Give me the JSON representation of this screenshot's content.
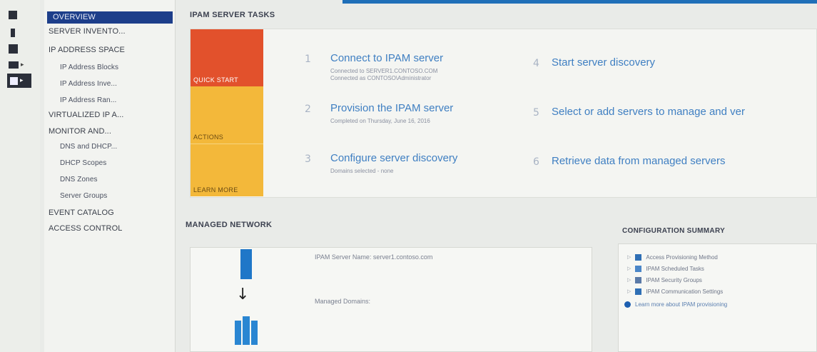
{
  "rail": {
    "icons": [
      "dashboard-icon",
      "server-icon",
      "servers-icon",
      "features-icon",
      "ipam-icon"
    ]
  },
  "nav": {
    "items": [
      {
        "label": "OVERVIEW",
        "level": 0,
        "selected": true
      },
      {
        "label": "SERVER INVENTO...",
        "level": 0
      },
      {
        "label": "IP ADDRESS SPACE",
        "level": 0
      },
      {
        "label": "IP Address Blocks",
        "level": 1
      },
      {
        "label": "IP Address Inve...",
        "level": 1
      },
      {
        "label": "IP Address Ran...",
        "level": 1
      },
      {
        "label": "VIRTUALIZED IP A...",
        "level": 0
      },
      {
        "label": "MONITOR AND...",
        "level": 0
      },
      {
        "label": "DNS and DHCP...",
        "level": 1
      },
      {
        "label": "DHCP Scopes",
        "level": 1
      },
      {
        "label": "DNS Zones",
        "level": 1
      },
      {
        "label": "Server Groups",
        "level": 1
      },
      {
        "label": "EVENT CATALOG",
        "level": 0
      },
      {
        "label": "ACCESS CONTROL",
        "level": 0
      }
    ]
  },
  "tasks": {
    "section_title": "IPAM SERVER TASKS",
    "tiles": [
      "QUICK START",
      "ACTIONS",
      "LEARN MORE"
    ],
    "items": [
      {
        "num": "1",
        "title": "Connect to IPAM server",
        "sub": [
          "Connected to SERVER1.CONTOSO.COM",
          "Connected as CONTOSO\\Administrator"
        ]
      },
      {
        "num": "2",
        "title": "Provision the IPAM server",
        "sub": [
          "Completed on Thursday, June 16, 2016"
        ]
      },
      {
        "num": "3",
        "title": "Configure server discovery",
        "sub": [
          "Domains selected - none"
        ]
      },
      {
        "num": "4",
        "title": "Start server discovery",
        "sub": []
      },
      {
        "num": "5",
        "title": "Select or add servers to manage and ver",
        "sub": []
      },
      {
        "num": "6",
        "title": "Retrieve data from managed servers",
        "sub": []
      }
    ]
  },
  "managed_network": {
    "section_title": "MANAGED NETWORK",
    "server_name": "IPAM Server Name: server1.contoso.com",
    "managed_domains": "Managed Domains:"
  },
  "config_summary": {
    "section_title": "CONFIGURATION SUMMARY",
    "items": [
      {
        "label": "Access Provisioning Method",
        "icon": "shield-icon"
      },
      {
        "label": "IPAM Scheduled Tasks",
        "icon": "calendar-icon"
      },
      {
        "label": "IPAM Security Groups",
        "icon": "users-icon"
      },
      {
        "label": "IPAM Communication Settings",
        "icon": "settings-icon"
      }
    ],
    "learn_more": "Learn more about IPAM provisioning"
  },
  "colors": {
    "accent": "#1f6fb8",
    "nav_selected": "#1d3e8a",
    "quick_start": "#e2512c",
    "actions": "#f3b83a",
    "link": "#3f7fc2"
  }
}
